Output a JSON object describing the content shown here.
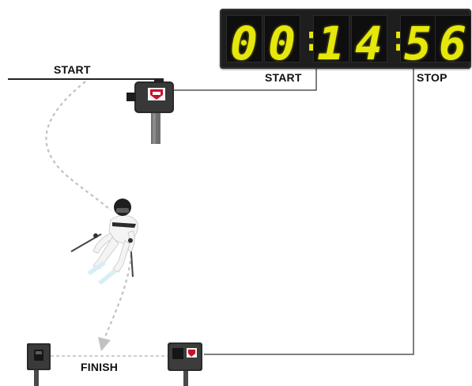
{
  "timer": {
    "display": "00:14:56",
    "digits": [
      "0",
      "0",
      "1",
      "4",
      "5",
      "6"
    ],
    "separator": ":",
    "digit_color": "#e5e80a",
    "panel_color": "#1e1e1e"
  },
  "labels": {
    "start_line": "START",
    "timer_start": "START",
    "timer_stop": "STOP",
    "finish": "FINISH"
  },
  "icons": {
    "start_gate": "start-gate-icon",
    "finish_photocell_left": "photocell-icon",
    "finish_photocell_right": "photocell-icon",
    "skier": "skier-icon"
  },
  "colors": {
    "wire": "#555555",
    "ski_path": "#bdbdbd",
    "beam": "#bdbdbd",
    "logo_red": "#c8102e"
  }
}
